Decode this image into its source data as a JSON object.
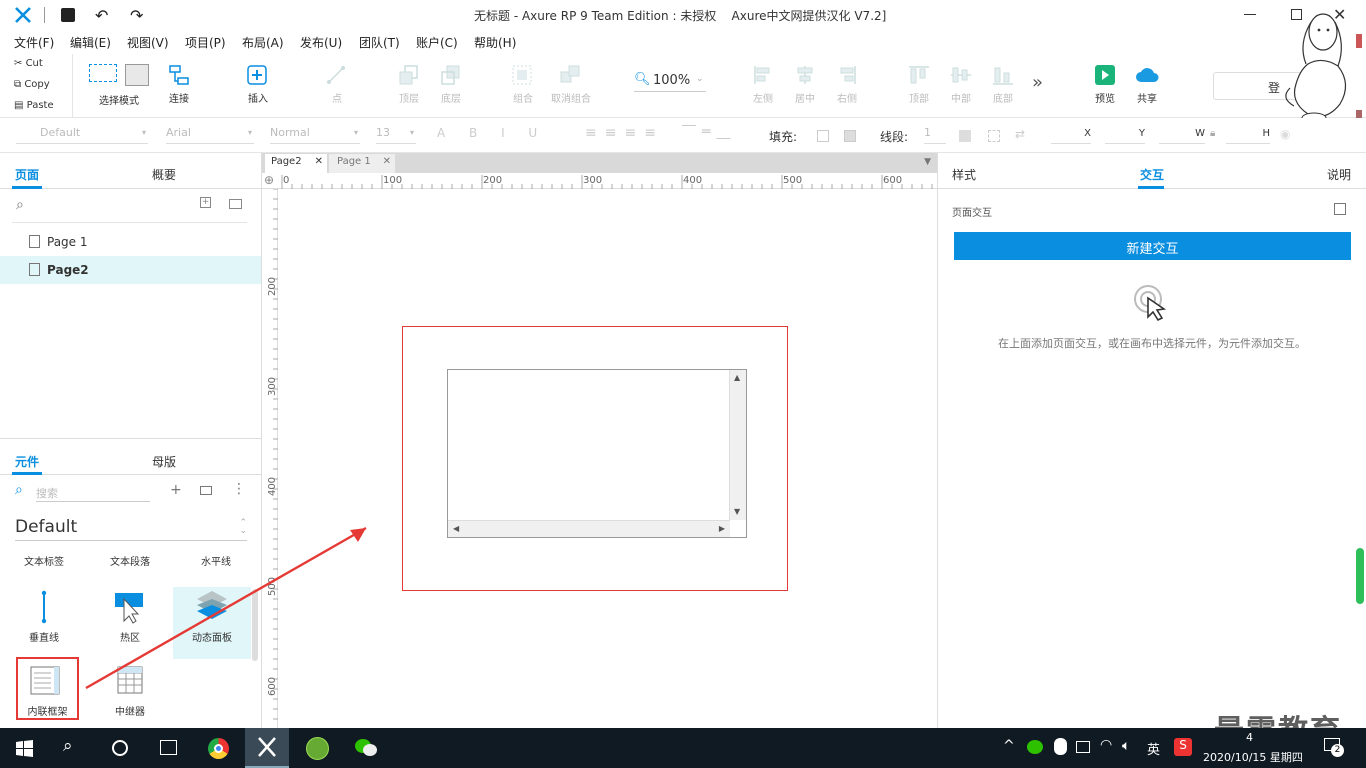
{
  "title_bar": {
    "title": "无标题 - Axure RP 9 Team Edition : 未授权    Axure中文网提供汉化 V7.2]"
  },
  "menu": [
    "文件(F)",
    "编辑(E)",
    "视图(V)",
    "项目(P)",
    "布局(A)",
    "发布(U)",
    "团队(T)",
    "账户(C)",
    "帮助(H)"
  ],
  "clipboard": {
    "cut": "Cut",
    "copy": "Copy",
    "paste": "Paste"
  },
  "toolbar": {
    "select_mode": "选择模式",
    "connect": "连接",
    "insert": "插入",
    "point": "点",
    "top": "顶层",
    "bottom": "底层",
    "group": "组合",
    "ungroup": "取消组合",
    "zoom": "100%",
    "left": "左侧",
    "center": "居中",
    "right": "右侧",
    "top_align": "顶部",
    "middle": "中部",
    "bottom_align": "底部",
    "more": "»",
    "preview": "预览",
    "share": "共享",
    "login": "登"
  },
  "format": {
    "style": "Default",
    "font": "Arial",
    "weight": "Normal",
    "size": "13",
    "fill": "填充:",
    "stroke": "线段:",
    "stroke_val": "1",
    "x": "X",
    "y": "Y",
    "w": "W",
    "h": "H"
  },
  "pages_panel": {
    "tab_pages": "页面",
    "tab_outline": "概要",
    "pages": [
      {
        "name": "Page 1",
        "selected": false
      },
      {
        "name": "Page2",
        "selected": true
      }
    ]
  },
  "widgets_panel": {
    "tab_widgets": "元件",
    "tab_masters": "母版",
    "search_placeholder": "搜索",
    "library": "Default",
    "row1": [
      "文本标签",
      "文本段落",
      "水平线"
    ],
    "row2": [
      "垂直线",
      "热区",
      "动态面板"
    ],
    "row3": [
      "内联框架",
      "中继器"
    ]
  },
  "canvas": {
    "tabs": [
      {
        "name": "Page2",
        "active": true
      },
      {
        "name": "Page 1",
        "active": false
      }
    ],
    "ruler_x": [
      "0",
      "100",
      "200",
      "300",
      "400",
      "500",
      "600"
    ],
    "ruler_y": [
      "200",
      "300",
      "400",
      "500",
      "600"
    ]
  },
  "right_panel": {
    "tab_style": "样式",
    "tab_interaction": "交互",
    "tab_notes": "说明",
    "page_interaction": "页面交互",
    "new_interaction": "新建交互",
    "hint": "在上面添加页面交互，或在画布中选择元件，为元件添加交互。"
  },
  "taskbar": {
    "ime": "英",
    "datetime": "2020/10/15 星期四",
    "time": "4",
    "notif": "2"
  },
  "watermark": "最需教育",
  "colors": {
    "accent": "#0a8ee0",
    "highlight": "#e0f6f8",
    "annotation_red": "#e53935"
  }
}
